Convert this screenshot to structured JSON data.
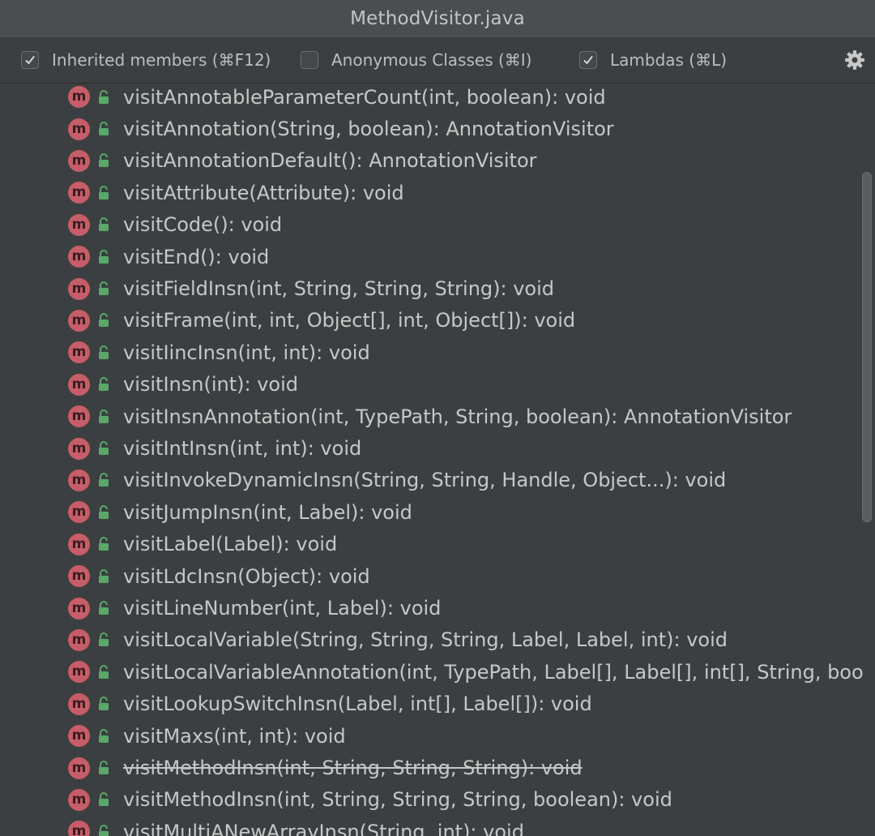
{
  "window": {
    "title": "MethodVisitor.java"
  },
  "toolbar": {
    "inherited": {
      "label": "Inherited members (⌘F12)",
      "checked": true
    },
    "anonymous": {
      "label": "Anonymous Classes (⌘I)",
      "checked": false
    },
    "lambdas": {
      "label": "Lambdas (⌘L)",
      "checked": true
    },
    "settings_icon": "gear-icon"
  },
  "colors": {
    "method_badge": "#c75d68",
    "lock_green": "#59a869",
    "background": "#3c3f41",
    "title_bar": "#4b4e50"
  },
  "members": [
    {
      "signature": "visitAnnotableParameterCount(int, boolean): void"
    },
    {
      "signature": "visitAnnotation(String, boolean): AnnotationVisitor"
    },
    {
      "signature": "visitAnnotationDefault(): AnnotationVisitor"
    },
    {
      "signature": "visitAttribute(Attribute): void"
    },
    {
      "signature": "visitCode(): void"
    },
    {
      "signature": "visitEnd(): void"
    },
    {
      "signature": "visitFieldInsn(int, String, String, String): void"
    },
    {
      "signature": "visitFrame(int, int, Object[], int, Object[]): void"
    },
    {
      "signature": "visitIincInsn(int, int): void"
    },
    {
      "signature": "visitInsn(int): void"
    },
    {
      "signature": "visitInsnAnnotation(int, TypePath, String, boolean): AnnotationVisitor"
    },
    {
      "signature": "visitIntInsn(int, int): void"
    },
    {
      "signature": "visitInvokeDynamicInsn(String, String, Handle, Object...): void"
    },
    {
      "signature": "visitJumpInsn(int, Label): void"
    },
    {
      "signature": "visitLabel(Label): void"
    },
    {
      "signature": "visitLdcInsn(Object): void"
    },
    {
      "signature": "visitLineNumber(int, Label): void"
    },
    {
      "signature": "visitLocalVariable(String, String, String, Label, Label, int): void"
    },
    {
      "signature": "visitLocalVariableAnnotation(int, TypePath, Label[], Label[], int[], String, boo"
    },
    {
      "signature": "visitLookupSwitchInsn(Label, int[], Label[]): void"
    },
    {
      "signature": "visitMaxs(int, int): void"
    },
    {
      "signature": "visitMethodInsn(int, String, String, String): void",
      "deprecated": true
    },
    {
      "signature": "visitMethodInsn(int, String, String, String, boolean): void"
    },
    {
      "signature": "visitMultiANewArrayInsn(String, int): void"
    }
  ],
  "badge_letter": "m"
}
